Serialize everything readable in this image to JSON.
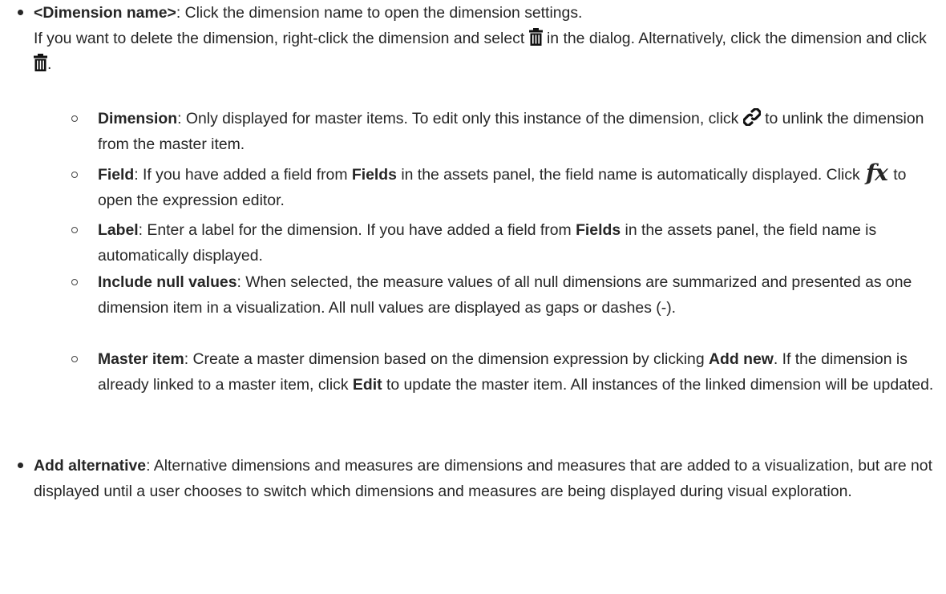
{
  "items": [
    {
      "bold": "<Dimension name>",
      "line1_rest": ": Click the dimension name to open the dimension settings.",
      "line2_a": "If you want to delete the dimension, right-click the dimension and select",
      "line2_b": "in the dialog. Alternatively, click the dimension and click",
      "line2_c": ".",
      "icon": "trash-icon",
      "subitems": [
        {
          "bold": "Dimension",
          "text_a": ": Only displayed for master items. To edit only this instance of the dimension, click",
          "text_b": "to unlink the dimension from the master item.",
          "icon": "unlink-icon"
        },
        {
          "bold": "Field",
          "text_a": ": If you have added a field from",
          "bold2": "Fields",
          "text_b": "in the assets panel, the field name is automatically displayed. Click",
          "icon_text": "fx",
          "text_c": "to open the expression editor."
        },
        {
          "bold": "Label",
          "text_a": ": Enter a label for the dimension. If you have added a field from",
          "bold2": "Fields",
          "text_b": "in the assets panel, the field name is automatically displayed."
        },
        {
          "bold": "Include null values",
          "text_a": ": When selected, the measure values of all null dimensions are summarized and presented as one dimension item in a visualization. All null values are displayed as gaps or dashes (-)."
        },
        {
          "bold": "Master item",
          "text_a": ": Create a master dimension based on the dimension expression by clicking",
          "bold2": "Add new",
          "text_b": ". If the dimension is already linked to a master item, click",
          "bold3": "Edit",
          "text_c": "to update the master item. All instances of the linked dimension will be updated."
        }
      ]
    },
    {
      "bold": "Add alternative",
      "text_a": ": Alternative dimensions and measures are dimensions and measures that are added to a visualization, but are not displayed until a user chooses to switch which dimensions and measures are being displayed during visual exploration."
    }
  ]
}
